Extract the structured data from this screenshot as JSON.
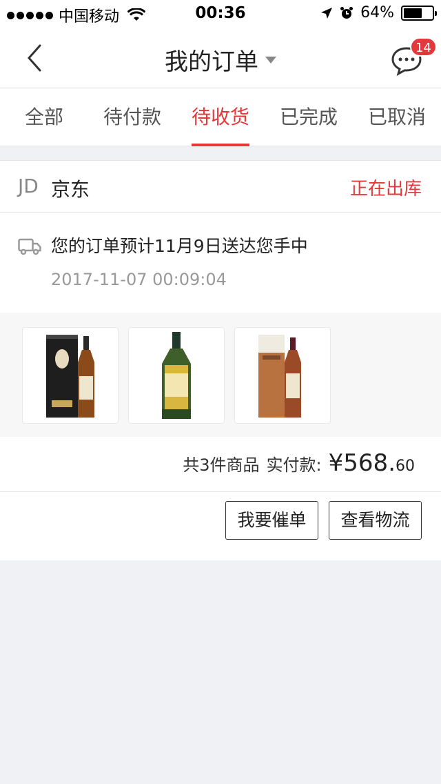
{
  "status_bar": {
    "carrier": "中国移动",
    "time": "00:36",
    "battery": "64%",
    "battery_level": 0.64
  },
  "nav": {
    "title": "我的订单",
    "message_badge": "14"
  },
  "tabs": [
    {
      "label": "全部",
      "active": false
    },
    {
      "label": "待付款",
      "active": false
    },
    {
      "label": "待收货",
      "active": true
    },
    {
      "label": "已完成",
      "active": false
    },
    {
      "label": "已取消",
      "active": false
    }
  ],
  "order": {
    "shop_logo": "JD",
    "shop_name": "京东",
    "status": "正在出库",
    "delivery_message": "您的订单预计11月9日送达您手中",
    "timestamp": "2017-11-07 00:09:04",
    "products": [
      {
        "name": "whisky-gift-box-black"
      },
      {
        "name": "whisky-bottle-green"
      },
      {
        "name": "whisky-gift-box-brown"
      }
    ],
    "summary": {
      "count_text": "共3件商品",
      "paid_label": "实付款:",
      "currency": "¥",
      "amount_int": "568.",
      "amount_dec": "60"
    },
    "buttons": {
      "urge": "我要催单",
      "logistics": "查看物流"
    }
  },
  "colors": {
    "accent": "#e4393c",
    "background": "#f0f1f5"
  }
}
